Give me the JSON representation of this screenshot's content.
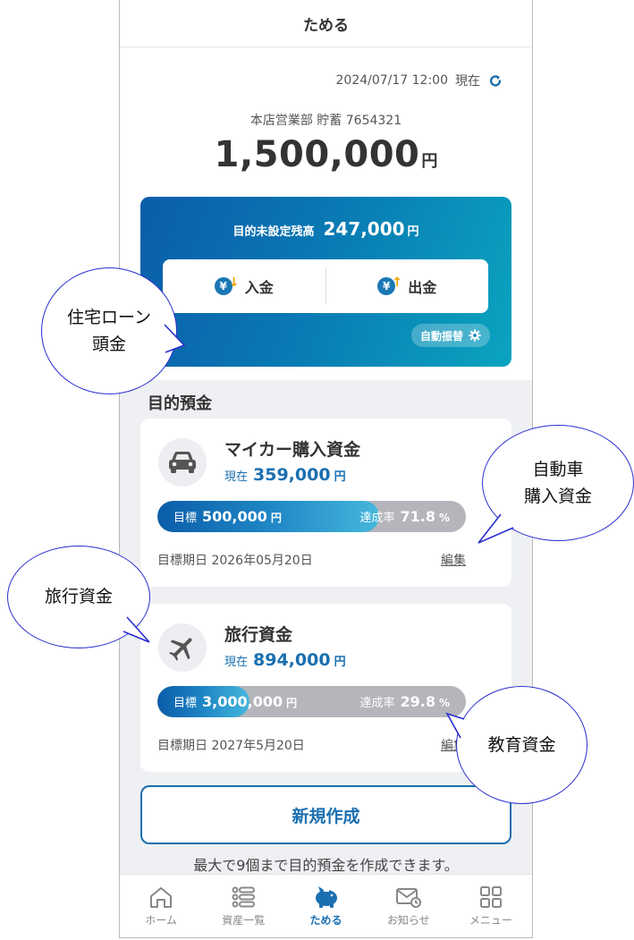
{
  "header": {
    "title": "ためる"
  },
  "status": {
    "datetime": "2024/07/17 12:00",
    "now_label": "現在"
  },
  "account": {
    "name": "本店営業部 貯蓄 7654321",
    "balance": "1,500,000",
    "yen": "円"
  },
  "card": {
    "unset_label": "目的未設定残高",
    "unset_amount": "247,000",
    "yen": "円",
    "deposit_label": "入金",
    "withdraw_label": "出金",
    "auto_label": "自動振替"
  },
  "section_title": "目的預金",
  "goals": [
    {
      "name": "マイカー購入資金",
      "current_label": "現在",
      "current": "359,000",
      "yen": "円",
      "target_label": "目標",
      "target": "500,000",
      "rate_label": "達成率",
      "rate": "71.8",
      "pct": "%",
      "progress": 0.718,
      "date": "目標期日 2026年05月20日",
      "edit": "編集",
      "icon": "car-icon"
    },
    {
      "name": "旅行資金",
      "current_label": "現在",
      "current": "894,000",
      "yen": "円",
      "target_label": "目標",
      "target": "3,000,000",
      "rate_label": "達成率",
      "rate": "29.8",
      "pct": "%",
      "progress": 0.298,
      "date": "目標期日 2027年5月20日",
      "edit": "編集",
      "icon": "airplane-icon"
    }
  ],
  "new_button": "新規作成",
  "note": "最大で9個まで目的預金を作成できます。",
  "tabs": [
    {
      "label": "ホーム",
      "icon": "home-icon"
    },
    {
      "label": "資産一覧",
      "icon": "list-icon"
    },
    {
      "label": "ためる",
      "icon": "piggy-bank-icon"
    },
    {
      "label": "お知らせ",
      "icon": "mail-icon"
    },
    {
      "label": "メニュー",
      "icon": "menu-grid-icon"
    }
  ],
  "callouts": {
    "loan": [
      "住宅ローン",
      "頭金"
    ],
    "car": [
      "自動車",
      "購入資金"
    ],
    "travel": "旅行資金",
    "education": "教育資金"
  },
  "colors": {
    "accent": "#1a6fb0",
    "card_start": "#0b5da9",
    "card_end": "#0aa4bf",
    "bubble_border": "#2a2fcf"
  }
}
